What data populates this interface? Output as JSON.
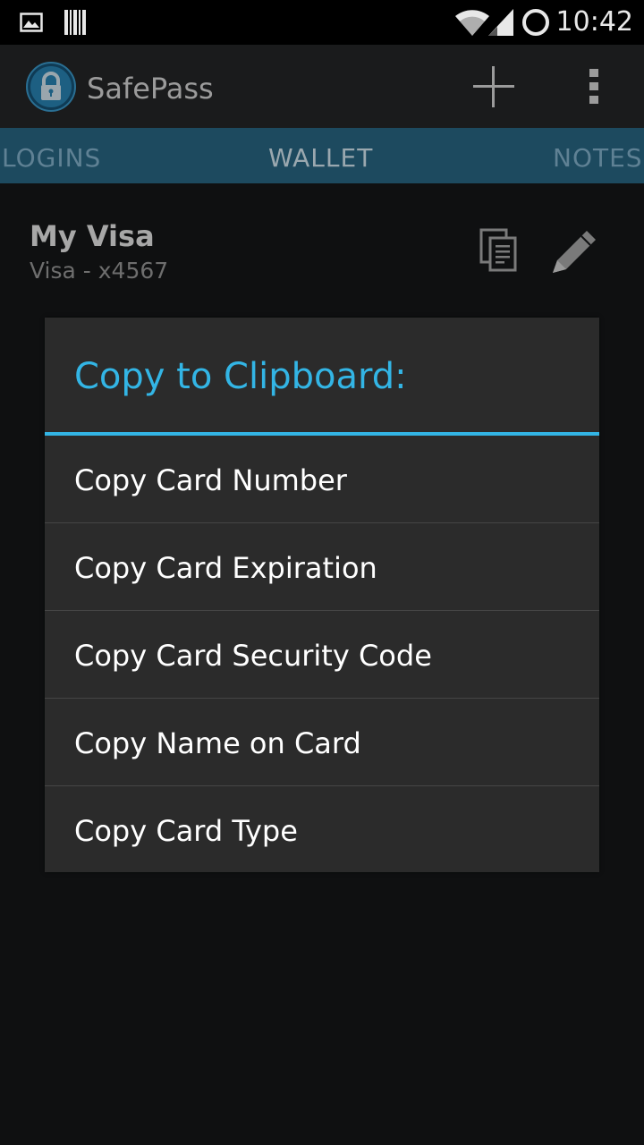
{
  "status_bar": {
    "time": "10:42",
    "icons": [
      "gallery-notification-icon",
      "barcode-notification-icon",
      "wifi-icon",
      "signal-icon",
      "battery-circle-icon"
    ]
  },
  "action_bar": {
    "title": "SafePass",
    "icons": [
      "app-lock-icon",
      "add-icon",
      "overflow-menu-icon"
    ]
  },
  "tabs": [
    {
      "label": "LOGINS",
      "active": false
    },
    {
      "label": "WALLET",
      "active": true
    },
    {
      "label": "NOTES",
      "active": false
    }
  ],
  "card": {
    "name": "My Visa",
    "subtitle": "Visa - x4567",
    "icons": [
      "copy-icon",
      "edit-pencil-icon"
    ]
  },
  "dialog": {
    "title": "Copy to Clipboard:",
    "options": [
      "Copy Card Number",
      "Copy Card Expiration",
      "Copy Card Security Code",
      "Copy Name on Card",
      "Copy Card Type"
    ]
  },
  "colors": {
    "accent": "#33b5e5",
    "tab_bar": "#1d4a5f",
    "dialog_bg": "#2b2b2b",
    "background": "#0f1011"
  }
}
